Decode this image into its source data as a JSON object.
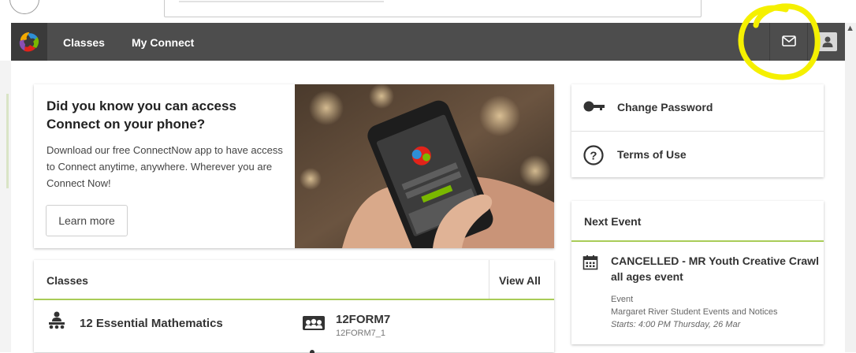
{
  "nav": {
    "links": [
      {
        "label": "Classes"
      },
      {
        "label": "My Connect"
      }
    ],
    "icons": {
      "logo": "connect-logo-icon",
      "mail": "mail-icon",
      "profile": "user-profile-icon"
    }
  },
  "promo": {
    "title": "Did you know you can access Connect on your phone?",
    "body": "Download our free ConnectNow app to have access to Connect anytime, anywhere. Wherever you are Connect Now!",
    "button": "Learn more"
  },
  "quick_links": [
    {
      "label": "Change Password",
      "icon": "key-icon"
    },
    {
      "label": "Terms of Use",
      "icon": "question-circle-icon"
    }
  ],
  "next_event": {
    "header": "Next Event",
    "title": "CANCELLED - MR Youth Creative Crawl all ages event",
    "type": "Event",
    "board": "Margaret River Student Events and Notices",
    "starts": "Starts: 4:00 PM Thursday, 26 Mar"
  },
  "classes": {
    "header": "Classes",
    "view_all": "View All",
    "items": [
      {
        "title": "12 Essential Mathematics",
        "subtitle": ""
      },
      {
        "title": "12FORM7",
        "subtitle": "12FORM7_1"
      }
    ]
  },
  "colors": {
    "nav_bg": "#4d4d4d",
    "accent_green": "#a9cc57",
    "highlight": "#f5f000"
  }
}
